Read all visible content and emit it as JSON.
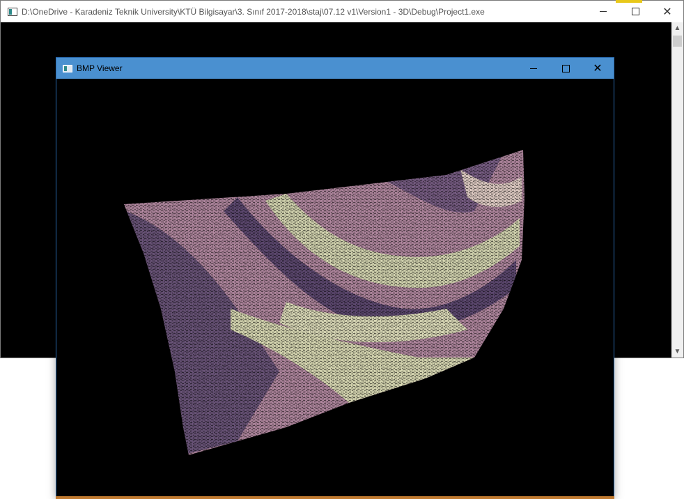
{
  "console": {
    "title": "D:\\OneDrive - Karadeniz Teknik University\\KTÜ Bilgisayar\\3. Sınıf 2017-2018\\staj\\07.12 v1\\Version1 - 3D\\Debug\\Project1.exe",
    "icon": "console-app-icon",
    "controls": {
      "minimize": "minimize-icon",
      "maximize": "maximize-icon",
      "close": "✕"
    }
  },
  "viewer": {
    "title": "BMP Viewer",
    "icon": "bmp-app-icon",
    "controls": {
      "minimize": "minimize-icon",
      "maximize": "maximize-icon",
      "close": "✕"
    },
    "image": {
      "description_colors": {
        "background": "#000000",
        "purple": "#5e4a6e",
        "pink": "#b68aa0",
        "cream": "#dcddb8"
      }
    }
  },
  "scrollbar": {
    "up": "▲",
    "down": "▼"
  }
}
